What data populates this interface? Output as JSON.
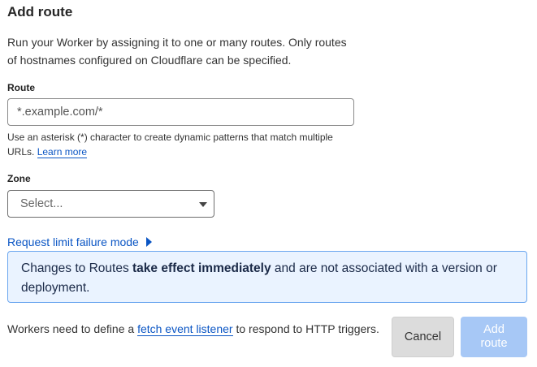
{
  "dialog": {
    "title": "Add route",
    "description": "Run your Worker by assigning it to one or many routes. Only routes of hostnames configured on Cloudflare can be specified."
  },
  "route": {
    "label": "Route",
    "placeholder": "*.example.com/*",
    "value": "",
    "help_text": "Use an asterisk (*) character to create dynamic patterns that match multiple URLs.",
    "help_link": "Learn more"
  },
  "zone": {
    "label": "Zone",
    "selected": "Select..."
  },
  "request_limit": {
    "label": "Request limit failure mode",
    "expanded": false
  },
  "notice": {
    "prefix": "Changes to Routes ",
    "emphasis": "take effect immediately",
    "suffix": " and are not associated with a version or deployment."
  },
  "footer": {
    "text_before": "Workers need to define a ",
    "link": "fetch event listener",
    "text_after": " to respond to HTTP triggers."
  },
  "buttons": {
    "cancel": "Cancel",
    "add": "Add route"
  },
  "colors": {
    "link": "#0a55c4",
    "notice_bg": "#eaf3ff",
    "notice_border": "#6aa6ef",
    "primary_disabled": "#a7c8f6",
    "secondary_bg": "#dcdcdc"
  }
}
